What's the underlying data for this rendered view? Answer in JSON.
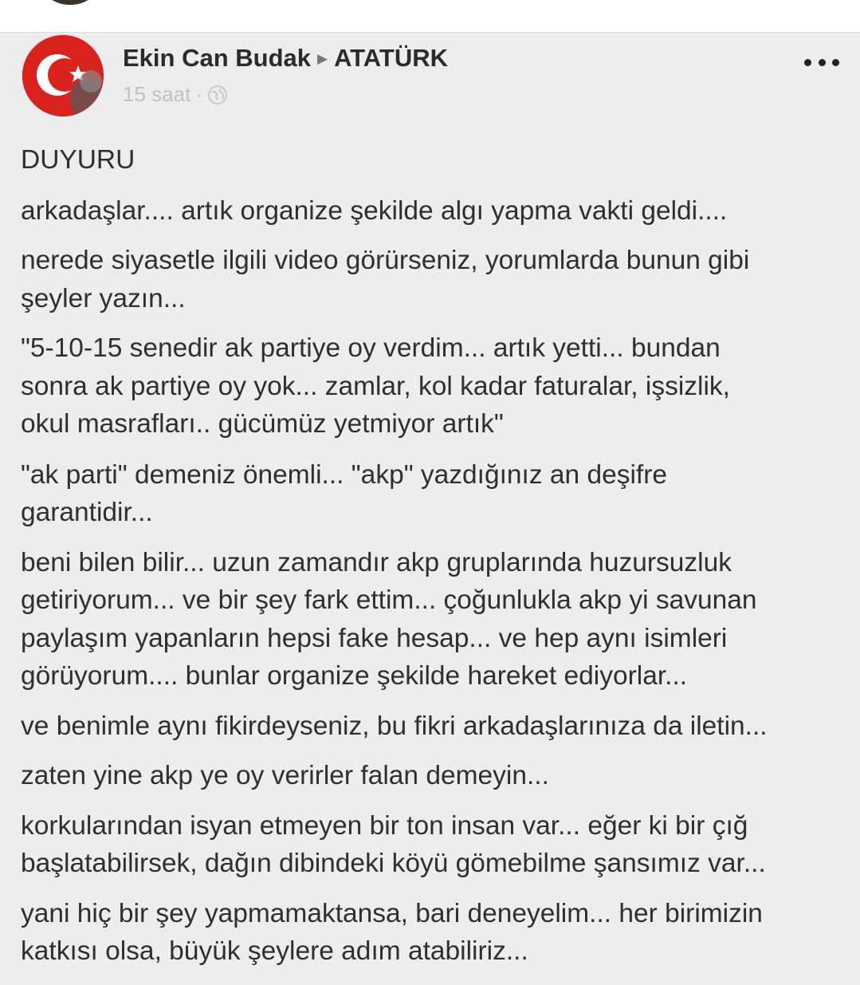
{
  "post": {
    "author_name": "Ekin Can Budak",
    "group_name": "ATATÜRK",
    "time": "15 saat",
    "meta_separator": "·",
    "icons": {
      "separator": "triangle-right-icon",
      "privacy": "globe-icon",
      "menu": "more-horizontal-icon",
      "avatar_colors": [
        "#d9221c",
        "#ffffff"
      ]
    },
    "paragraphs": [
      [
        "DUYURU"
      ],
      [
        "arkadaşlar.... artık organize şekilde algı yapma vakti geldi...."
      ],
      [
        "nerede siyasetle ilgili video görürseniz, yorumlarda bunun gibi",
        "şeyler yazın..."
      ],
      [
        "\"5-10-15 senedir ak partiye oy verdim... artık yetti... bundan",
        "sonra ak partiye oy yok... zamlar, kol kadar faturalar, işsizlik,",
        "okul masrafları.. gücümüz yetmiyor artık\""
      ],
      [
        "\"ak parti\" demeniz önemli... \"akp\" yazdığınız an deşifre",
        "garantidir..."
      ],
      [
        "beni bilen bilir... uzun zamandır akp gruplarında huzursuzluk",
        "getiriyorum... ve bir şey fark ettim... çoğunlukla akp yi savunan",
        "paylaşım yapanların hepsi fake hesap... ve hep aynı isimleri",
        "görüyorum.... bunlar organize şekilde hareket ediyorlar..."
      ],
      [
        "ve benimle aynı fikirdeyseniz, bu fikri arkadaşlarınıza da iletin..."
      ],
      [
        "zaten yine akp ye oy verirler falan demeyin..."
      ],
      [
        "korkularından isyan etmeyen bir ton insan var... eğer ki bir çığ",
        "başlatabilirsek, dağın dibindeki köyü gömebilme şansımız var..."
      ],
      [
        "yani hiç bir şey yapmamaktansa, bari deneyelim... her birimizin",
        "katkısı olsa, büyük şeylere adım atabiliriz..."
      ]
    ]
  }
}
